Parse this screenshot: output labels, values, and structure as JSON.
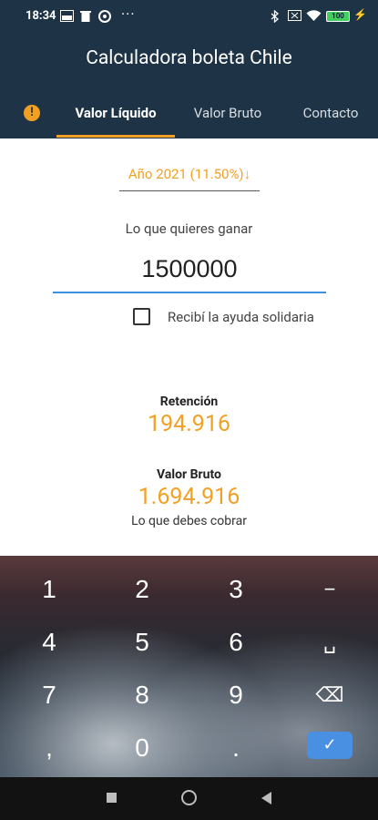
{
  "status_bar": {
    "time": "18:34",
    "more": "···",
    "battery": "100",
    "icons": [
      "image-icon",
      "trash-icon",
      "settings-icon",
      "bluetooth-icon",
      "sim-icon",
      "wifi-icon",
      "battery-icon",
      "charging-icon"
    ]
  },
  "app_bar": {
    "title": "Calculadora boleta Chile",
    "tabs": [
      {
        "label": "Valor Líquido",
        "active": true
      },
      {
        "label": "Valor Bruto",
        "active": false
      },
      {
        "label": "Contacto",
        "active": false
      }
    ],
    "accent": "#f2a023",
    "background": "#1e3446"
  },
  "main": {
    "year_select": "Año 2021 (11.50%)",
    "input_label": "Lo que quieres ganar",
    "input_value": "1500000",
    "checkbox_label": "Recibí la ayuda solidaria",
    "checkbox_checked": false,
    "retention_label": "Retención",
    "retention_value": "194.916",
    "gross_label": "Valor Bruto",
    "gross_value": "1.694.916",
    "gross_sub": "Lo que debes cobrar"
  },
  "keyboard": {
    "rows": [
      [
        "1",
        "2",
        "3",
        "−"
      ],
      [
        "4",
        "5",
        "6",
        "␣"
      ],
      [
        "7",
        "8",
        "9",
        "⌫"
      ],
      [
        ",",
        "0",
        ".",
        "✓"
      ]
    ]
  }
}
